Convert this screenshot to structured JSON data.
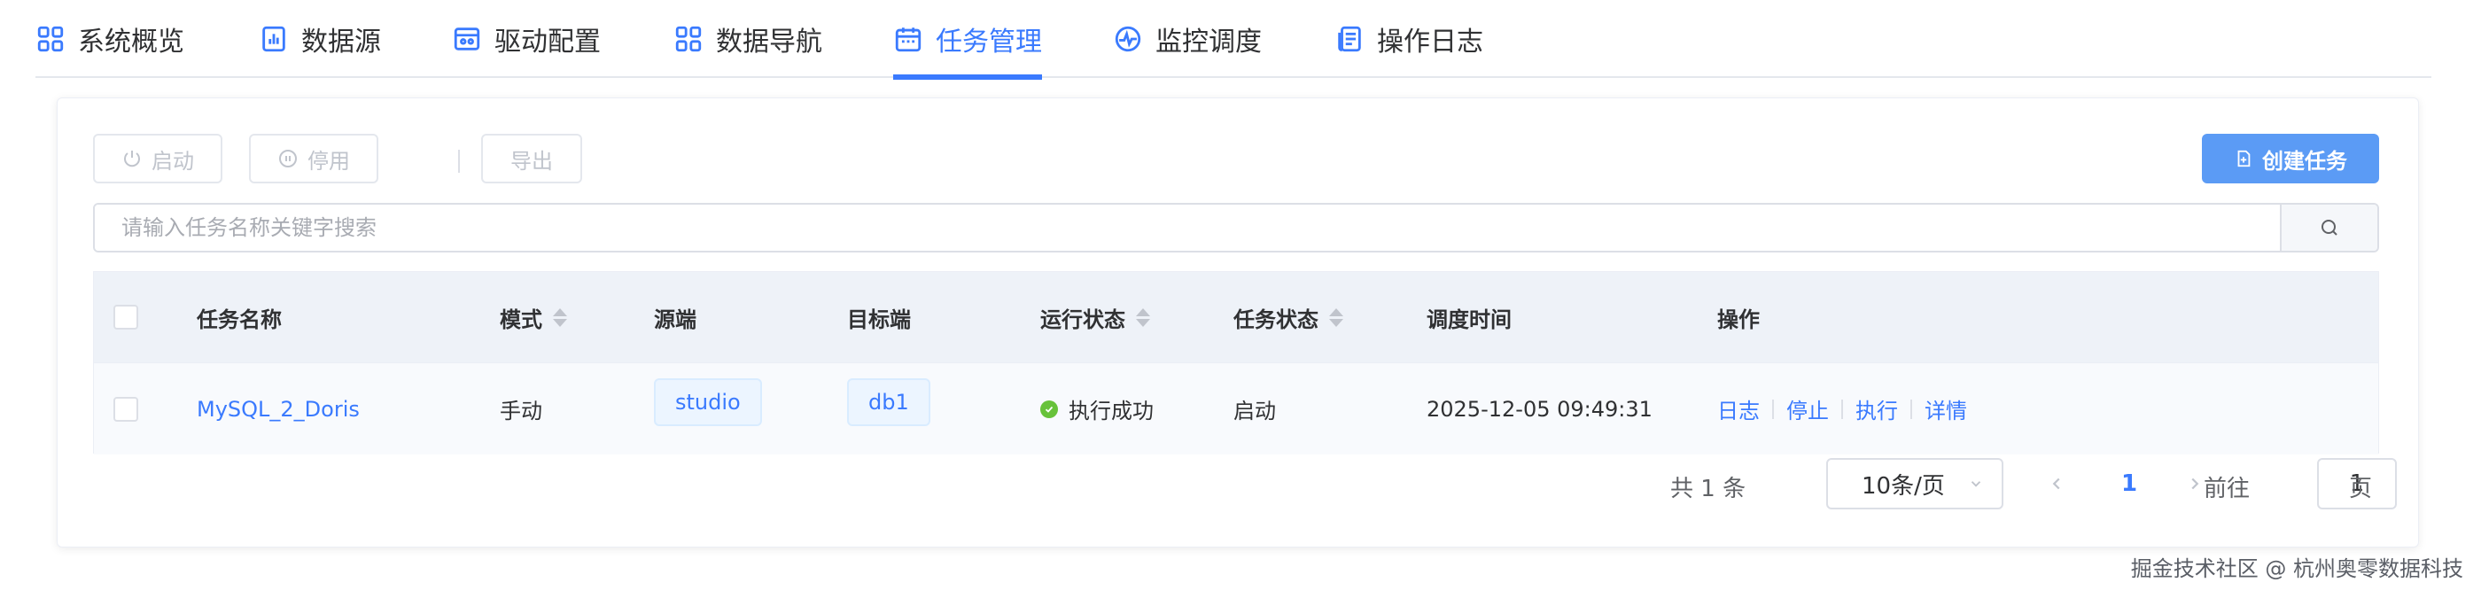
{
  "nav": {
    "items": [
      {
        "label": "系统概览",
        "icon": "grid-icon"
      },
      {
        "label": "数据源",
        "icon": "chart-icon"
      },
      {
        "label": "驱动配置",
        "icon": "driver-icon"
      },
      {
        "label": "数据导航",
        "icon": "grid-icon"
      },
      {
        "label": "任务管理",
        "icon": "calendar-icon"
      },
      {
        "label": "监控调度",
        "icon": "pulse-icon"
      },
      {
        "label": "操作日志",
        "icon": "document-icon"
      }
    ],
    "active_index": 4
  },
  "toolbar": {
    "start_label": "启动",
    "stop_label": "停用",
    "export_label": "导出",
    "create_label": "创建任务"
  },
  "search": {
    "placeholder": "请输入任务名称关键字搜索",
    "value": ""
  },
  "table": {
    "headers": {
      "name": "任务名称",
      "mode": "模式",
      "source": "源端",
      "target": "目标端",
      "run_status": "运行状态",
      "task_status": "任务状态",
      "schedule_time": "调度时间",
      "actions": "操作"
    },
    "rows": [
      {
        "name": "MySQL_2_Doris",
        "mode": "手动",
        "source": "studio",
        "target": "db1",
        "run_status": "执行成功",
        "task_status": "启动",
        "schedule_time": "2025-12-05 09:49:31",
        "actions": [
          "日志",
          "停止",
          "执行",
          "详情"
        ]
      }
    ]
  },
  "pagination": {
    "total_text": "共 1 条",
    "page_size": "10条/页",
    "current_page": "1",
    "goto_prefix": "前往",
    "goto_value": "1",
    "goto_suffix": "页"
  },
  "watermark": "掘金技术社区 @ 杭州奥零数据科技",
  "colors": {
    "accent": "#3a7afe",
    "primary_button": "#5b9bf5",
    "success": "#67c23a"
  }
}
